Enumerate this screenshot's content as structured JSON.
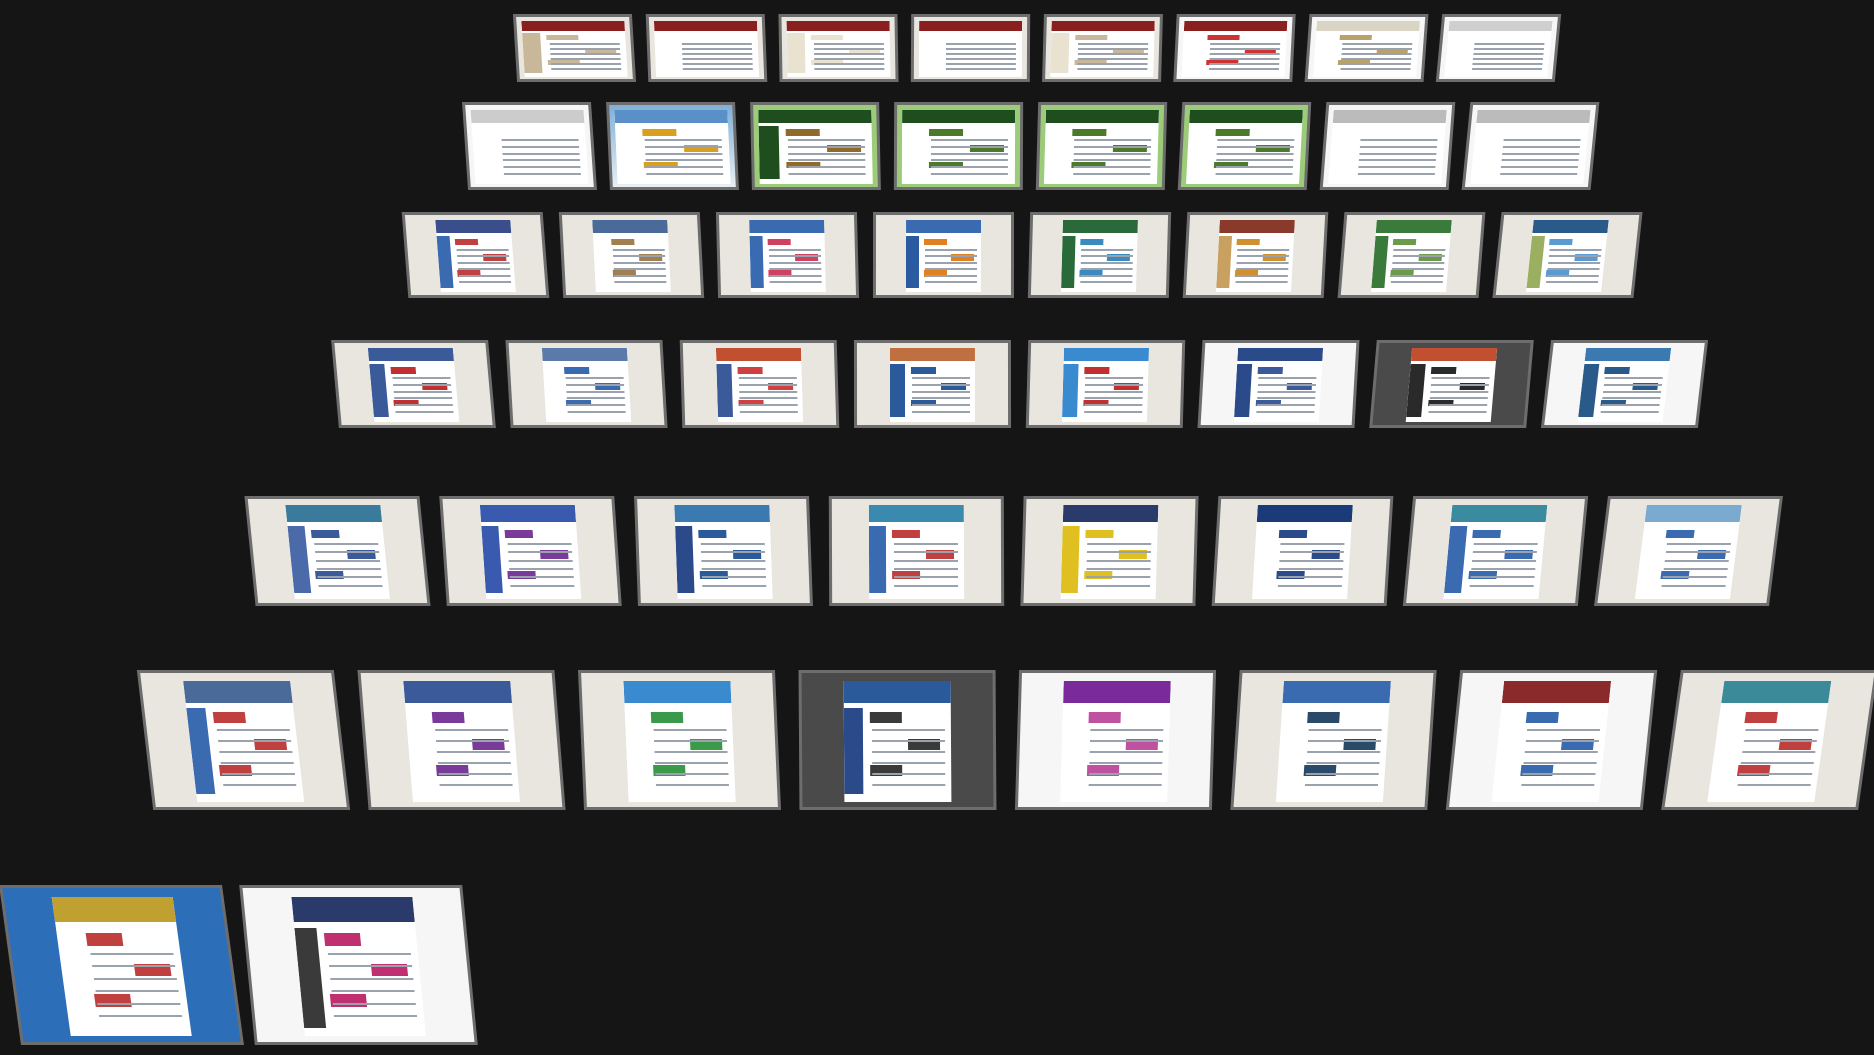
{
  "view": {
    "title": "",
    "background_color": "#151515"
  },
  "tile_style": {
    "frame_color": "#6d6d6d"
  },
  "rows": [
    {
      "row": 1,
      "tiles": [
        {
          "bg": "light",
          "header": "#8a1f1f",
          "accent": "#c9b79a",
          "col": "#c9b79a"
        },
        {
          "bg": "light",
          "header": "#8a1f1f",
          "accent": "#ffffff",
          "col": "#ffffff"
        },
        {
          "bg": "light",
          "header": "#8a1f1f",
          "accent": "#e9e2d0",
          "col": "#e9e2d0"
        },
        {
          "bg": "light",
          "header": "#8a1f1f",
          "accent": "#ffffff",
          "col": "#ffffff"
        },
        {
          "bg": "light",
          "header": "#8a1f1f",
          "accent": "#c9b79a",
          "col": "#e9e2d0"
        },
        {
          "bg": "white",
          "header": "#8a1f1f",
          "accent": "#c33",
          "col": "#ffffff"
        },
        {
          "bg": "white",
          "header": "#d9d4c3",
          "accent": "#b7a36a",
          "col": "#ffffff"
        },
        {
          "bg": "white",
          "header": "#cfcfcf",
          "accent": "#ffffff",
          "col": "#ffffff"
        }
      ]
    },
    {
      "row": 2,
      "tiles": [
        {
          "bg": "white",
          "header": "#cccccc",
          "accent": "#ffffff",
          "col": "#ffffff"
        },
        {
          "bg": "sky",
          "header": "#5b8fc7",
          "accent": "#d9a020",
          "col": "#ffffff"
        },
        {
          "bg": "green",
          "header": "#1e4d1e",
          "accent": "#8f6a2a",
          "col": "#1e4d1e"
        },
        {
          "bg": "green",
          "header": "#1e4d1e",
          "accent": "#4a7a2a",
          "col": "#ffffff"
        },
        {
          "bg": "green",
          "header": "#1e4d1e",
          "accent": "#4a7a2a",
          "col": "#ffffff"
        },
        {
          "bg": "green",
          "header": "#1e4d1e",
          "accent": "#4a7a2a",
          "col": "#ffffff"
        },
        {
          "bg": "white",
          "header": "#bbbbbb",
          "accent": "#ffffff",
          "col": "#ffffff"
        },
        {
          "bg": "white",
          "header": "#bbbbbb",
          "accent": "#ffffff",
          "col": "#ffffff"
        }
      ]
    },
    {
      "row": 3,
      "tiles": [
        {
          "bg": "light",
          "header": "#3a4e8c",
          "accent": "#c04040",
          "col": "#3a6ab0"
        },
        {
          "bg": "light",
          "header": "#4a6a9a",
          "accent": "#a08050",
          "col": "#ffffff"
        },
        {
          "bg": "light",
          "header": "#3a6ab0",
          "accent": "#d04060",
          "col": "#3a6ab0"
        },
        {
          "bg": "light",
          "header": "#3a6ab0",
          "accent": "#e08020",
          "col": "#2a5aa0"
        },
        {
          "bg": "light",
          "header": "#2a6a3a",
          "accent": "#3a8ac0",
          "col": "#2a6a3a"
        },
        {
          "bg": "light",
          "header": "#8a3a2a",
          "accent": "#d09030",
          "col": "#c8a060"
        },
        {
          "bg": "light",
          "header": "#3a7a3a",
          "accent": "#6a9a4a",
          "col": "#3a7a3a"
        },
        {
          "bg": "light",
          "header": "#2a5a8a",
          "accent": "#5a9ad0",
          "col": "#9ab060"
        }
      ]
    },
    {
      "row": 4,
      "tiles": [
        {
          "bg": "light",
          "header": "#3a5a9a",
          "accent": "#c03030",
          "col": "#3a5a9a"
        },
        {
          "bg": "light",
          "header": "#5a7aaa",
          "accent": "#3a6ab0",
          "col": "#ffffff"
        },
        {
          "bg": "light",
          "header": "#c05030",
          "accent": "#d04040",
          "col": "#3a5a9a"
        },
        {
          "bg": "light",
          "header": "#c07040",
          "accent": "#2a5a9a",
          "col": "#2a5a9a"
        },
        {
          "bg": "light",
          "header": "#3a8ad0",
          "accent": "#c03030",
          "col": "#3a8ad0"
        },
        {
          "bg": "white",
          "header": "#2a4a8a",
          "accent": "#3a5a9a",
          "col": "#2a4a8a"
        },
        {
          "bg": "dark",
          "header": "#c05030",
          "accent": "#2a2a2a",
          "col": "#2a2a2a"
        },
        {
          "bg": "white",
          "header": "#3a7ab0",
          "accent": "#2a5a8a",
          "col": "#2a5a8a"
        }
      ]
    },
    {
      "row": 5,
      "tiles": [
        {
          "bg": "light",
          "header": "#3a7a9a",
          "accent": "#3a5a9a",
          "col": "#4a6aaa"
        },
        {
          "bg": "light",
          "header": "#3a5ab0",
          "accent": "#7a3a9a",
          "col": "#3a5ab0"
        },
        {
          "bg": "light",
          "header": "#3a7ab0",
          "accent": "#2a5a9a",
          "col": "#2a4a8a"
        },
        {
          "bg": "light",
          "header": "#3a8ab0",
          "accent": "#c04040",
          "col": "#3a6ab0"
        },
        {
          "bg": "light",
          "header": "#2a3a6a",
          "accent": "#e0c020",
          "col": "#e0c020"
        },
        {
          "bg": "light",
          "header": "#1a3a7a",
          "accent": "#2a4a8a",
          "col": "#ffffff"
        },
        {
          "bg": "light",
          "header": "#3a8aa0",
          "accent": "#3a6ab0",
          "col": "#3a6ab0"
        },
        {
          "bg": "light",
          "header": "#7aaad0",
          "accent": "#3a6ab0",
          "col": "#ffffff"
        }
      ]
    },
    {
      "row": 6,
      "tiles": [
        {
          "bg": "light",
          "header": "#4a6a9a",
          "accent": "#c04040",
          "col": "#3a6ab0"
        },
        {
          "bg": "light",
          "header": "#3a5a9a",
          "accent": "#7a3a9a",
          "col": "#ffffff"
        },
        {
          "bg": "light",
          "header": "#3a8ad0",
          "accent": "#3a9a4a",
          "col": "#ffffff"
        },
        {
          "bg": "dark",
          "header": "#2a5a9a",
          "accent": "#3a3a3a",
          "col": "#2a4a8a"
        },
        {
          "bg": "white",
          "header": "#7a2a9a",
          "accent": "#c050a0",
          "col": "#ffffff"
        },
        {
          "bg": "light",
          "header": "#3a6ab0",
          "accent": "#2a4a6a",
          "col": "#ffffff"
        },
        {
          "bg": "white",
          "header": "#8a2a2a",
          "accent": "#3a6ab0",
          "col": "#ffffff"
        },
        {
          "bg": "light",
          "header": "#3a8a9a",
          "accent": "#c04040",
          "col": "#ffffff"
        }
      ]
    },
    {
      "row": 7,
      "tiles": [
        {
          "bg": "blue",
          "header": "#c0a030",
          "accent": "#c04040",
          "col": "#ffffff"
        },
        {
          "bg": "white",
          "header": "#2a3a6a",
          "accent": "#c03070",
          "col": "#3a3a3a"
        }
      ]
    }
  ]
}
